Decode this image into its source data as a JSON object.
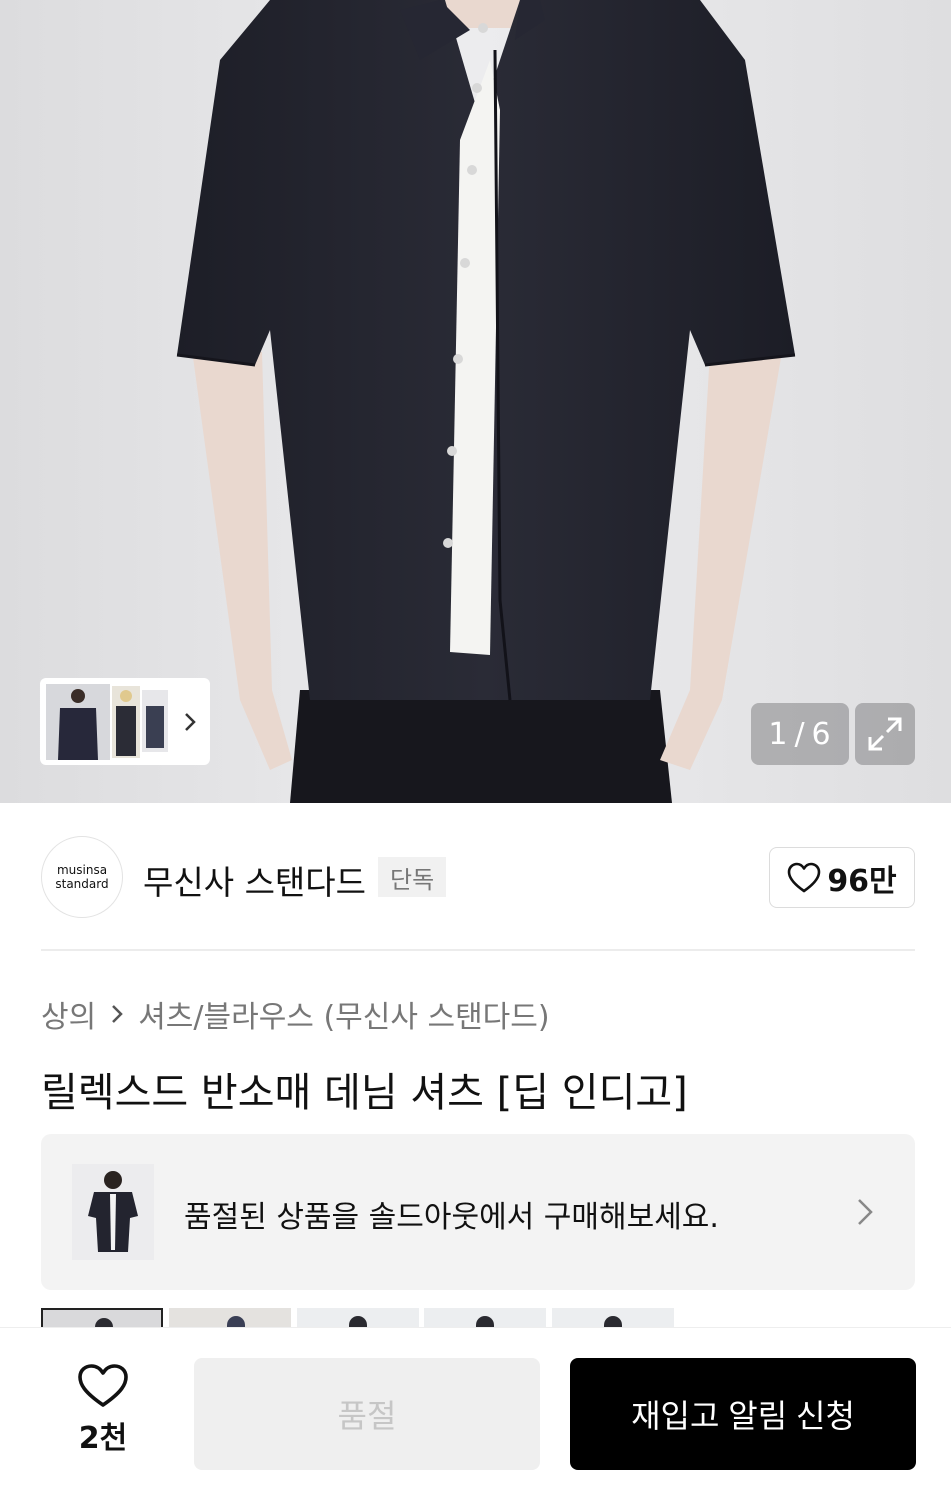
{
  "gallery": {
    "counter_current": "1",
    "counter_separator": "/",
    "counter_total": "6"
  },
  "brand": {
    "logo_line1": "musinsa",
    "logo_line2": "standard",
    "name": "무신사 스탠다드",
    "badge": "단독",
    "like_count": "96만"
  },
  "breadcrumb": {
    "level1": "상의",
    "level2": "셔츠/블라우스 (무신사 스탠다드)"
  },
  "product": {
    "title": "릴렉스드 반소매 데님 셔츠 [딥 인디고]"
  },
  "soldout_banner": {
    "text": "품절된 상품을 솔드아웃에서 구매해보세요."
  },
  "bottom_bar": {
    "wish_count": "2천",
    "soldout_label": "품절",
    "restock_label": "재입고 알림 신청"
  },
  "colors": {
    "accent": "#000000",
    "shirt": "#22232d",
    "background": "#e6e6e8"
  }
}
